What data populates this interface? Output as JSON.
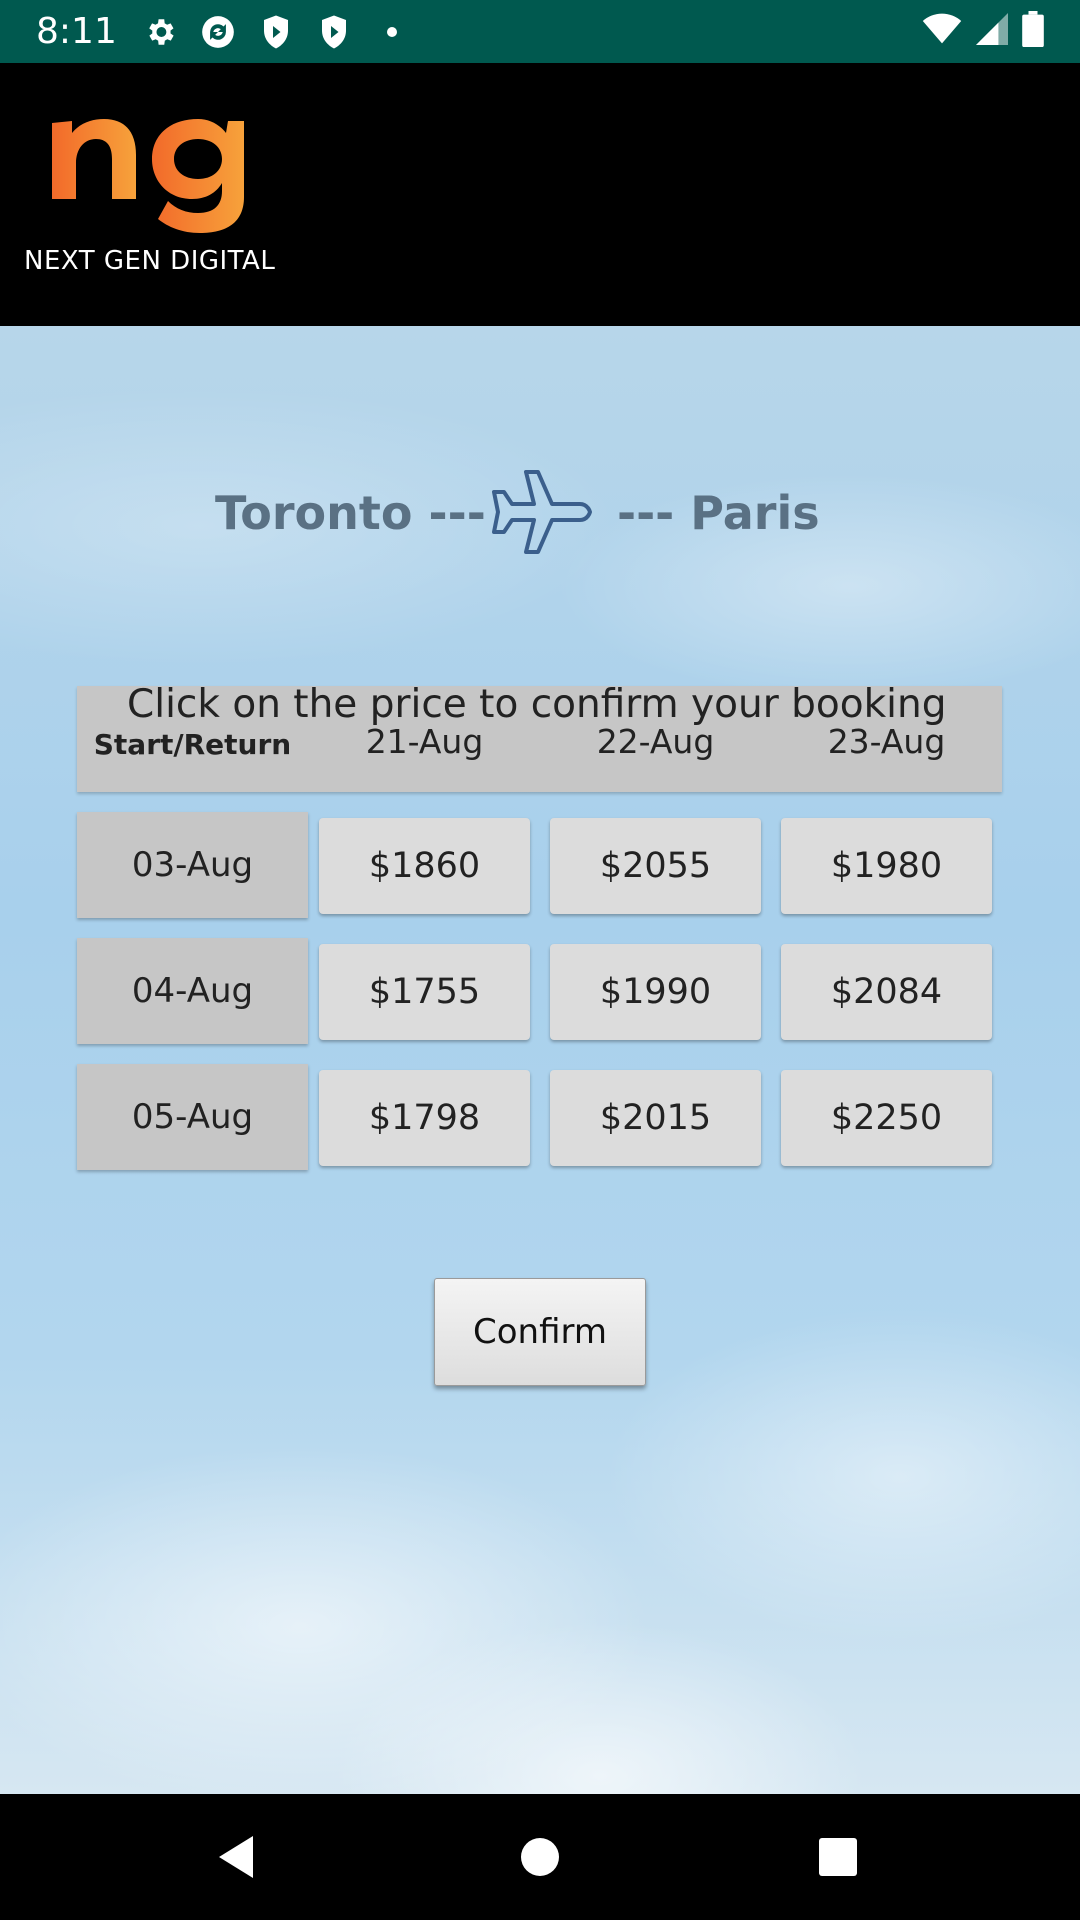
{
  "status_bar": {
    "time": "8:11",
    "icons_left": [
      "settings-icon",
      "sync-icon",
      "shield-play-icon",
      "shield-play-icon",
      "dot-icon"
    ],
    "icons_right": [
      "wifi-icon",
      "signal-icon",
      "battery-icon"
    ]
  },
  "header": {
    "logo_mark": "ng",
    "logo_text": "NEXT GEN DIGITAL",
    "logo_color_start": "#f26a2a",
    "logo_color_end": "#f7a23b"
  },
  "route": {
    "from": "Toronto ---",
    "to": "--- Paris",
    "icon": "airplane-icon"
  },
  "booking": {
    "instruction": "Click on the price to confirm your booking",
    "corner_label": "Start/Return",
    "return_dates": [
      "21-Aug",
      "22-Aug",
      "23-Aug"
    ],
    "rows": [
      {
        "start": "03-Aug",
        "prices": [
          "$1860",
          "$2055",
          "$1980"
        ]
      },
      {
        "start": "04-Aug",
        "prices": [
          "$1755",
          "$1990",
          "$2084"
        ]
      },
      {
        "start": "05-Aug",
        "prices": [
          "$1798",
          "$2015",
          "$2250"
        ]
      }
    ]
  },
  "actions": {
    "confirm_label": "Confirm"
  },
  "nav_bar": {
    "buttons": [
      "back-icon",
      "home-icon",
      "recents-icon"
    ]
  }
}
